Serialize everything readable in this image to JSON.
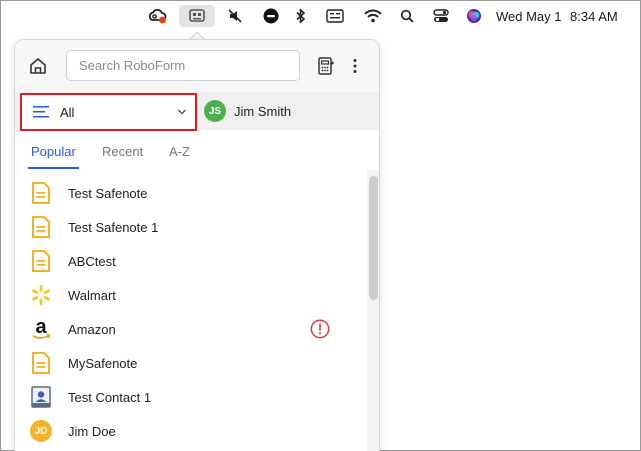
{
  "menubar": {
    "date": "Wed May 1",
    "time": "8:34 AM",
    "icons": [
      "creative-cloud-icon",
      "roboform-icon",
      "mute-icon",
      "focus-icon",
      "bluetooth-icon",
      "input-source-icon",
      "wifi-icon",
      "spotlight-icon",
      "control-center-icon",
      "siri-icon"
    ]
  },
  "header": {
    "search_placeholder": "Search RoboForm"
  },
  "filter": {
    "folder_label": "All",
    "user_initials": "JS",
    "user_name": "Jim Smith",
    "user_color": "#4caf50"
  },
  "tabs": [
    {
      "label": "Popular",
      "active": true
    },
    {
      "label": "Recent",
      "active": false
    },
    {
      "label": "A-Z",
      "active": false
    }
  ],
  "items": [
    {
      "name": "Test Safenote",
      "icon": "safenote-icon"
    },
    {
      "name": "Test Safenote 1",
      "icon": "safenote-icon"
    },
    {
      "name": "ABCtest",
      "icon": "safenote-icon"
    },
    {
      "name": "Walmart",
      "icon": "walmart-icon"
    },
    {
      "name": "Amazon",
      "icon": "amazon-icon",
      "warning": true
    },
    {
      "name": "MySafenote",
      "icon": "safenote-icon"
    },
    {
      "name": "Test Contact 1",
      "icon": "contact-icon"
    },
    {
      "name": "Jim Doe",
      "icon": "avatar",
      "initials": "JD"
    }
  ],
  "colors": {
    "accent": "#2a5bd7",
    "highlight": "#e01b24",
    "safenote": "#f2b22b",
    "walmart": "#ffc220",
    "warning": "#e53935"
  }
}
